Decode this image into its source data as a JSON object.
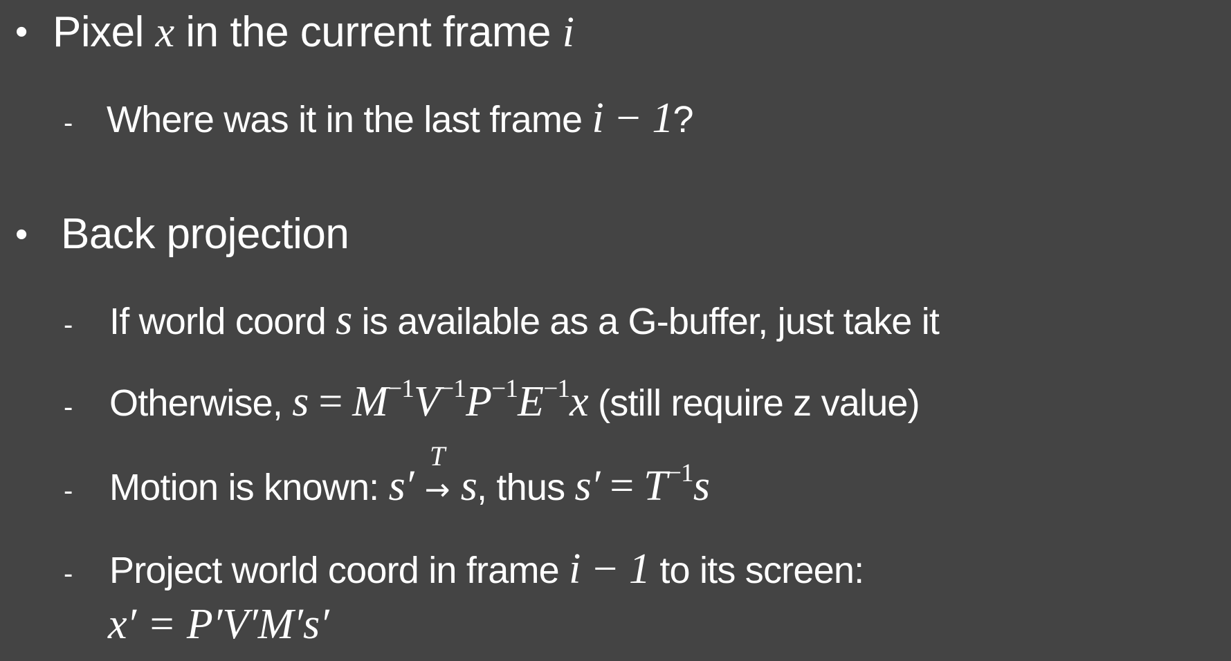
{
  "bullets": [
    {
      "text": "Pixel",
      "math_x": "x",
      "text2": " in the current frame ",
      "math_i": "i",
      "subitems": [
        {
          "text": "Where was it in the last frame ",
          "math": "i − 1",
          "suffix": "?"
        }
      ]
    },
    {
      "text": "Back projection",
      "subitems": [
        {
          "prefix": "If world coord ",
          "math": "s",
          "suffix": " is available as a G-buffer, just take it"
        },
        {
          "prefix": "Otherwise, ",
          "math_s": "s",
          "math_eq": " = ",
          "m1": "M",
          "v1": "V",
          "p1": "P",
          "e1": "E",
          "x1": "x",
          "sup": "−1",
          "suffix": " (still require z value)"
        },
        {
          "prefix": "Motion is known: ",
          "s_prime": "s′",
          "arrow_top": "T",
          "arrow": "→",
          "s": "s",
          "mid": ", thus ",
          "s_prime2": "s′",
          "eq": " = ",
          "T": "T",
          "sup": "−1",
          "s2": "s"
        },
        {
          "prefix": "Project world coord in frame ",
          "math": "i − 1",
          "suffix": " to its screen:",
          "formula": "x′ = P′V′M′s′"
        }
      ]
    }
  ]
}
